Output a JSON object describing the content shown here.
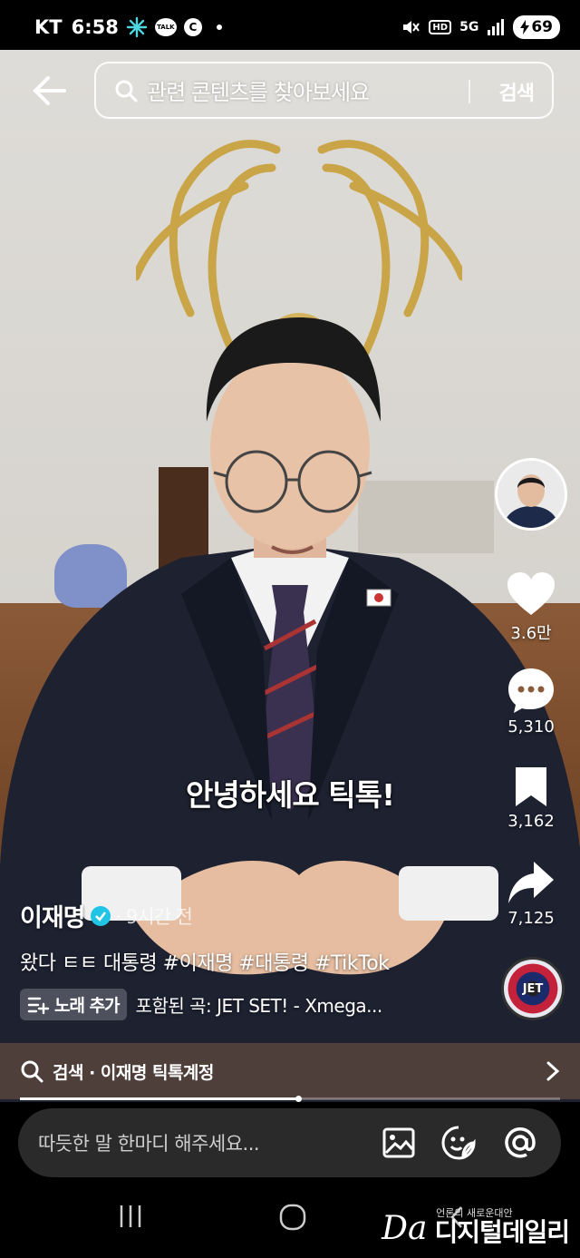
{
  "status_bar": {
    "carrier": "KT",
    "time": "6:58",
    "talk_badge": "TALK",
    "c_badge": "C",
    "hd": "HD",
    "network": "5G",
    "battery": "69",
    "icons": [
      "perplexity-icon",
      "kakaotalk-icon",
      "c-icon",
      "mute-icon",
      "hd-icon",
      "5g-icon",
      "signal-icon",
      "battery-icon"
    ]
  },
  "top": {
    "search_placeholder": "관련 콘텐츠를 찾아보세요",
    "search_button": "검색"
  },
  "video": {
    "subtitle": "안녕하세요 틱톡!"
  },
  "actions": {
    "likes": "3.6만",
    "comments": "5,310",
    "saves": "3,162",
    "shares": "7,125",
    "disc_label": "JET"
  },
  "post": {
    "author": "이재명",
    "time": "· 9시간 전",
    "caption": "왔다 ㅌㅌ 대통령 #이재명 #대통령 #TikTok",
    "add_song": "노래 추가",
    "music": "포함된 곡: JET SET! - Xmega..."
  },
  "search_link": {
    "label": "검색 · 이재명 틱톡계정"
  },
  "progress": {
    "fraction": 0.515
  },
  "comment": {
    "placeholder": "따듯한 말 한마디 해주세요..."
  },
  "watermark": {
    "logo": "Da",
    "tagline": "언론의 새로운대안",
    "name": "디지털데일리"
  },
  "colors": {
    "verified": "#20c5e6",
    "background": "#000000"
  }
}
